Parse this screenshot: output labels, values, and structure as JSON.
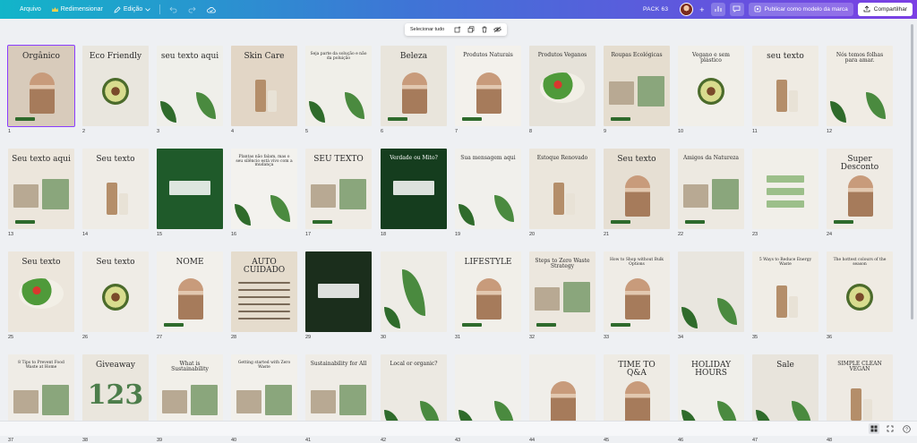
{
  "topbar": {
    "file_label": "Arquivo",
    "resize_label": "Redimensionar",
    "edit_label": "Edição",
    "project_name": "PACK 63",
    "publish_label": "Publicar como modelo da marca",
    "share_label": "Compartilhar",
    "add_symbol": "+",
    "colors": {
      "gradient_start": "#12b5c9",
      "gradient_mid": "#3f74d6",
      "gradient_end": "#7b3fe4"
    }
  },
  "floating_toolbar": {
    "select_all_label": "Selecionar tudo",
    "icons": [
      "add-page-icon",
      "duplicate-icon",
      "delete-icon",
      "hide-icon"
    ]
  },
  "pages": [
    {
      "num": "1",
      "bg": "#d8cbbb",
      "text": "Orgânico",
      "theme": "portrait",
      "selected": true
    },
    {
      "num": "2",
      "bg": "#e9e6de",
      "text": "Eco Friendly",
      "theme": "avocado"
    },
    {
      "num": "3",
      "bg": "#efefea",
      "text": "seu texto aqui",
      "theme": "plant"
    },
    {
      "num": "4",
      "bg": "#e2d6c6",
      "text": "Skin Care",
      "theme": "bottle"
    },
    {
      "num": "5",
      "bg": "#f0efe9",
      "text": "Seja parte da solução e não da poluição",
      "theme": "leaf"
    },
    {
      "num": "6",
      "bg": "#e9e5dc",
      "text": "Beleza",
      "theme": "portrait"
    },
    {
      "num": "7",
      "bg": "#f3f1ec",
      "text": "Produtos Naturais",
      "theme": "portrait"
    },
    {
      "num": "8",
      "bg": "#e6e2d9",
      "text": "Produtos Veganos",
      "theme": "salad"
    },
    {
      "num": "9",
      "bg": "#e5ddcf",
      "text": "Roupas Ecológicas",
      "theme": "collage"
    },
    {
      "num": "10",
      "bg": "#f1efe9",
      "text": "Vegano e sem plástico",
      "theme": "avocado"
    },
    {
      "num": "11",
      "bg": "#efebe3",
      "text": "seu texto",
      "theme": "bottle"
    },
    {
      "num": "12",
      "bg": "#f0ece4",
      "text": "Nós temos folhas para amar.",
      "theme": "plant"
    },
    {
      "num": "13",
      "bg": "#ece6dc",
      "text": "Seu texto aqui",
      "theme": "collage"
    },
    {
      "num": "14",
      "bg": "#efece6",
      "text": "Seu texto",
      "theme": "bottle"
    },
    {
      "num": "15",
      "bg": "#1f5a2a",
      "text": "",
      "theme": "darkleaf"
    },
    {
      "num": "16",
      "bg": "#f3f2ee",
      "text": "Plantas não falam, mas o seu silêncio está vivo com a mudança",
      "theme": "leaf"
    },
    {
      "num": "17",
      "bg": "#efebe4",
      "text": "SEU TEXTO",
      "theme": "collage"
    },
    {
      "num": "18",
      "bg": "#153d1e",
      "text": "Verdade ou Mito?",
      "theme": "darkleaf"
    },
    {
      "num": "19",
      "bg": "#f1f0ec",
      "text": "Sua mensagem aqui",
      "theme": "leaf"
    },
    {
      "num": "20",
      "bg": "#ebe6dc",
      "text": "Estoque Renovado",
      "theme": "bottle"
    },
    {
      "num": "21",
      "bg": "#e6dfd3",
      "text": "Seu texto",
      "theme": "portrait"
    },
    {
      "num": "22",
      "bg": "#ede9e1",
      "text": "Amigos da Natureza",
      "theme": "collage"
    },
    {
      "num": "23",
      "bg": "#f1efe9",
      "text": "",
      "theme": "checklist"
    },
    {
      "num": "24",
      "bg": "#efebe4",
      "text": "Super Desconto",
      "theme": "portrait"
    },
    {
      "num": "25",
      "bg": "#ece6dc",
      "text": "Seu texto",
      "theme": "salad"
    },
    {
      "num": "26",
      "bg": "#efece6",
      "text": "Seu texto",
      "theme": "avocado"
    },
    {
      "num": "27",
      "bg": "#f2f0eb",
      "text": "NOME",
      "theme": "portrait"
    },
    {
      "num": "28",
      "bg": "#e5dccd",
      "text": "AUTO CUIDADO",
      "theme": "text"
    },
    {
      "num": "29",
      "bg": "#1b2e1c",
      "text": "",
      "theme": "darkleaf"
    },
    {
      "num": "30",
      "bg": "#eeece6",
      "text": "",
      "theme": "fern"
    },
    {
      "num": "31",
      "bg": "#f1efe9",
      "text": "LIFESTYLE",
      "theme": "portrait"
    },
    {
      "num": "32",
      "bg": "#ece7de",
      "text": "Steps to Zero Waste Strategy",
      "theme": "collage"
    },
    {
      "num": "33",
      "bg": "#efece6",
      "text": "How to Shop without Bulk Options",
      "theme": "portrait"
    },
    {
      "num": "34",
      "bg": "#e9e6df",
      "text": "",
      "theme": "leaf"
    },
    {
      "num": "35",
      "bg": "#f0ede6",
      "text": "5 Ways to Reduce Energy Waste",
      "theme": "bottle"
    },
    {
      "num": "36",
      "bg": "#efebe3",
      "text": "The hottest colours of the season",
      "theme": "avocado"
    },
    {
      "num": "37",
      "bg": "#efece6",
      "text": "8 Tips to Prevent Food Waste at Home",
      "theme": "collage"
    },
    {
      "num": "38",
      "bg": "#eae6dd",
      "text": "Giveaway",
      "theme": "number"
    },
    {
      "num": "39",
      "bg": "#f1efe9",
      "text": "What is Sustainability",
      "theme": "collage"
    },
    {
      "num": "40",
      "bg": "#f2f0eb",
      "text": "Getting started with Zero Waste",
      "theme": "collage"
    },
    {
      "num": "41",
      "bg": "#efece6",
      "text": "Sustainability for All",
      "theme": "collage"
    },
    {
      "num": "42",
      "bg": "#ece9e2",
      "text": "Local or organic?",
      "theme": "leaf"
    },
    {
      "num": "43",
      "bg": "#f1f0ec",
      "text": "",
      "theme": "leaf"
    },
    {
      "num": "44",
      "bg": "#f0eee9",
      "text": "",
      "theme": "portrait"
    },
    {
      "num": "45",
      "bg": "#eeebe4",
      "text": "TIME TO Q&A",
      "theme": "portrait"
    },
    {
      "num": "46",
      "bg": "#f0efea",
      "text": "HOLIDAY HOURS",
      "theme": "leaf"
    },
    {
      "num": "47",
      "bg": "#e8e4dc",
      "text": "Sale",
      "theme": "plant"
    },
    {
      "num": "48",
      "bg": "#eeeae3",
      "text": "SIMPLE CLEAN VEGAN",
      "theme": "bottle"
    }
  ],
  "bottombar": {
    "icons": [
      "grid-view-icon",
      "expand-icon",
      "help-icon"
    ]
  }
}
